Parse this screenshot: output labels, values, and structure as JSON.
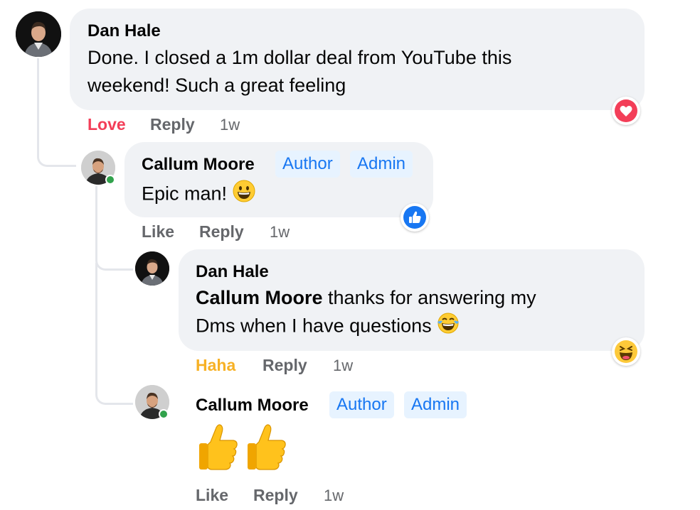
{
  "comments": [
    {
      "author": "Dan Hale",
      "text_line1": "Done. I closed a 1m dollar deal from YouTube this",
      "text_line2": "weekend! Such a great feeling",
      "reaction_label": "Love",
      "reply_label": "Reply",
      "time": "1w",
      "reaction_icon": "heart-reaction-icon"
    },
    {
      "author": "Callum Moore",
      "badges": [
        "Author",
        "Admin"
      ],
      "text": "Epic man!",
      "text_emoji": "grinning-face-icon",
      "like_label": "Like",
      "reply_label": "Reply",
      "time": "1w",
      "reaction_icon": "like-reaction-icon"
    },
    {
      "author": "Dan Hale",
      "mention": "Callum Moore",
      "text_after_mention": " thanks for answering my",
      "text_line2": "Dms when I have questions",
      "text_emoji": "tears-of-joy-icon",
      "reaction_label": "Haha",
      "reply_label": "Reply",
      "time": "1w",
      "reaction_icon": "haha-reaction-icon"
    },
    {
      "author": "Callum Moore",
      "badges": [
        "Author",
        "Admin"
      ],
      "content_emojis": [
        "thumbs-up-icon",
        "thumbs-up-icon"
      ],
      "like_label": "Like",
      "reply_label": "Reply",
      "time": "1w"
    }
  ],
  "colors": {
    "bubble": "#f0f2f5",
    "love": "#f33e58",
    "haha": "#f7b125",
    "badge_bg": "#e7f3ff",
    "badge_text": "#1877f2",
    "online": "#31a24c"
  }
}
